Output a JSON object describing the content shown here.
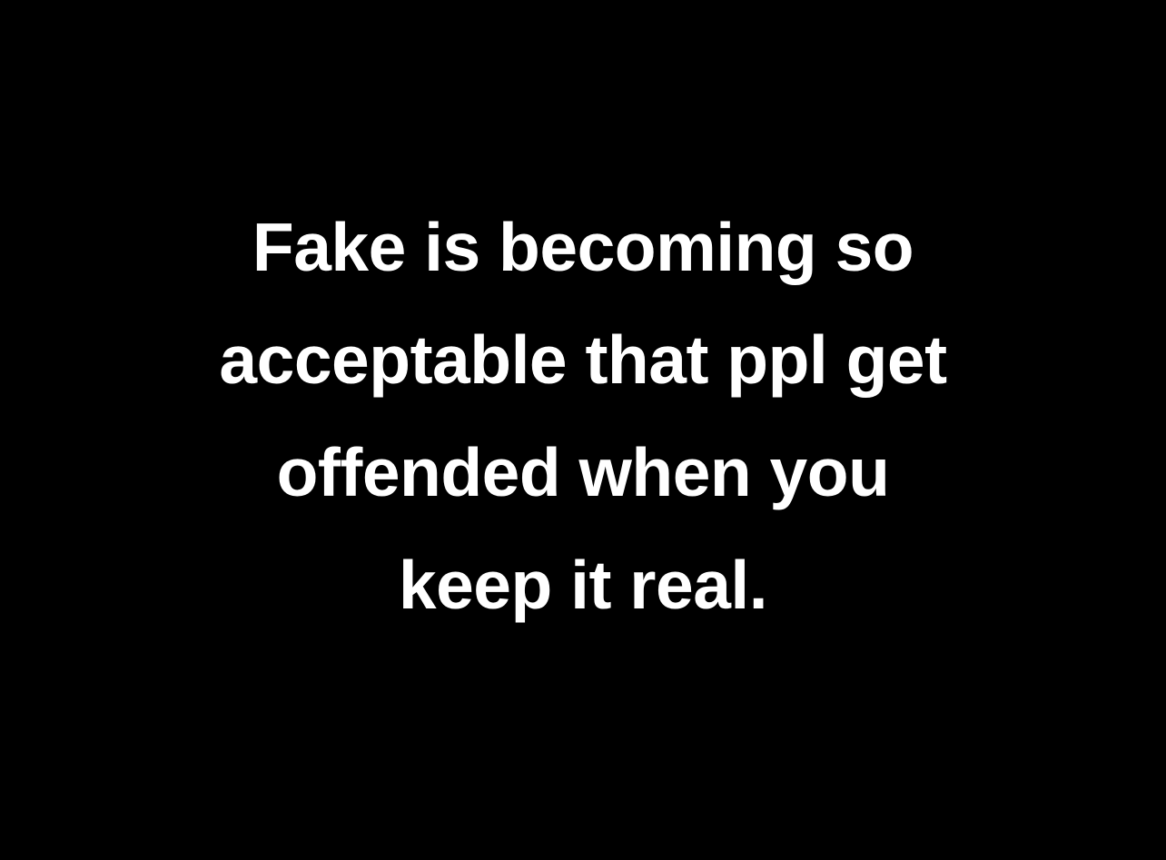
{
  "colors": {
    "background": "#000000",
    "text": "#ffffff"
  },
  "quote": {
    "lines": [
      "Fake is becoming so",
      "acceptable that ppl get",
      "offended when you",
      "keep it real."
    ]
  }
}
